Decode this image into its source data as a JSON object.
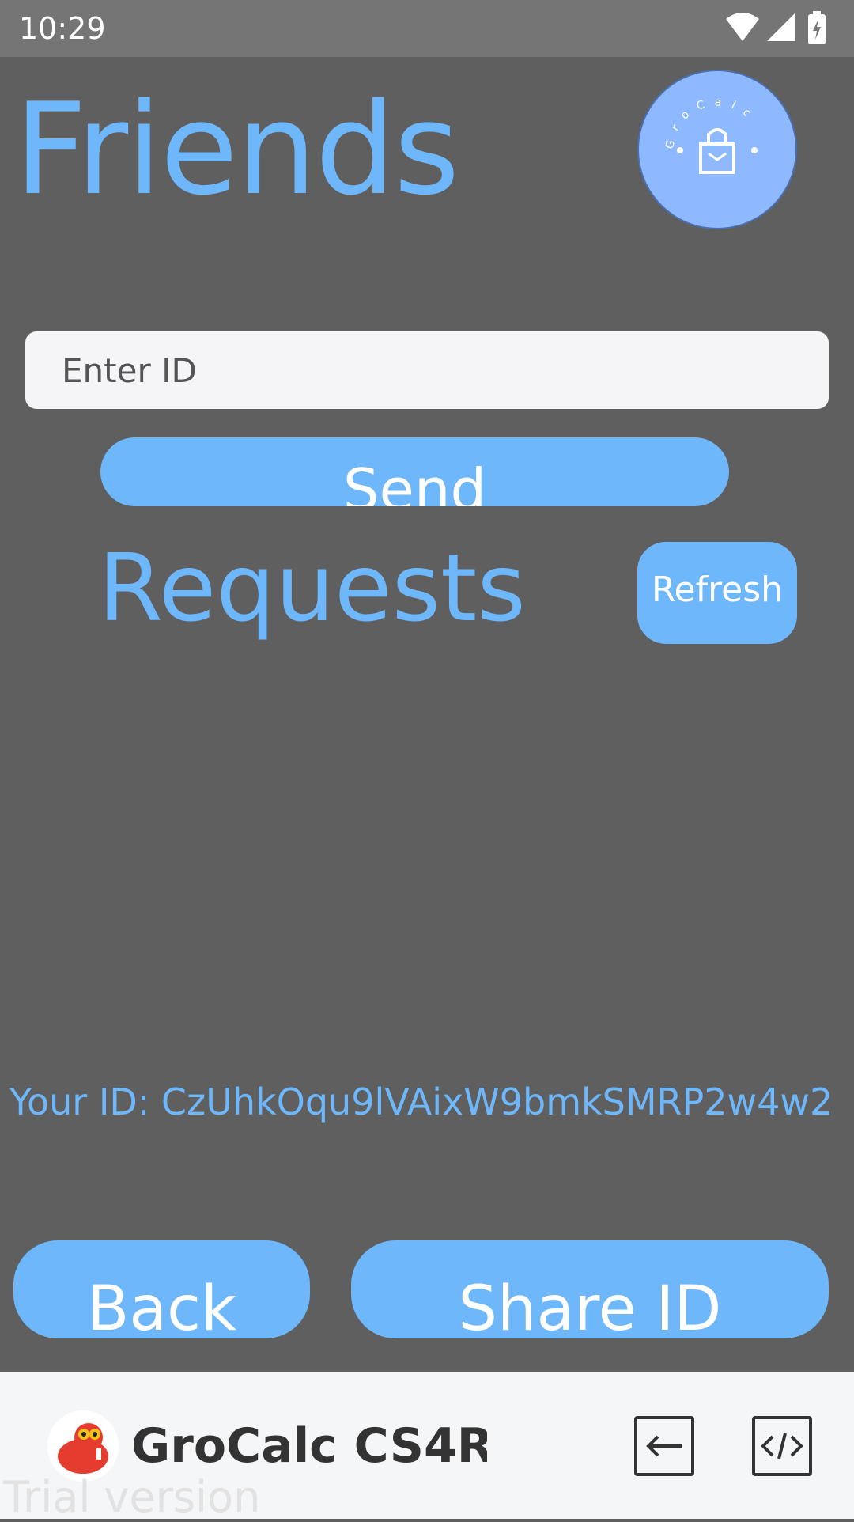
{
  "status_bar": {
    "time": "10:29",
    "icons": [
      "wifi-icon",
      "cell-signal-icon",
      "battery-charging-icon"
    ]
  },
  "header": {
    "title": "Friends",
    "logo_text": "GroCalc"
  },
  "add_friend": {
    "placeholder": "Enter ID",
    "value": "",
    "send_label": "Send"
  },
  "requests": {
    "title": "Requests",
    "refresh_label": "Refresh",
    "items": []
  },
  "user": {
    "id_text": "Your ID: CzUhkOqu9lVAixW9bmkSMRP2w4w2"
  },
  "actions": {
    "back_label": "Back",
    "share_label": "Share ID"
  },
  "app_bar": {
    "app_name": "GroCalc CS4R...",
    "watermark": "Trial version",
    "icons": [
      "exit-icon",
      "code-icon"
    ]
  },
  "colors": {
    "background": "#5f5f5f",
    "accent": "#6eb7fb",
    "status_bar": "#757575",
    "logo_fill": "#8fb9ff"
  }
}
